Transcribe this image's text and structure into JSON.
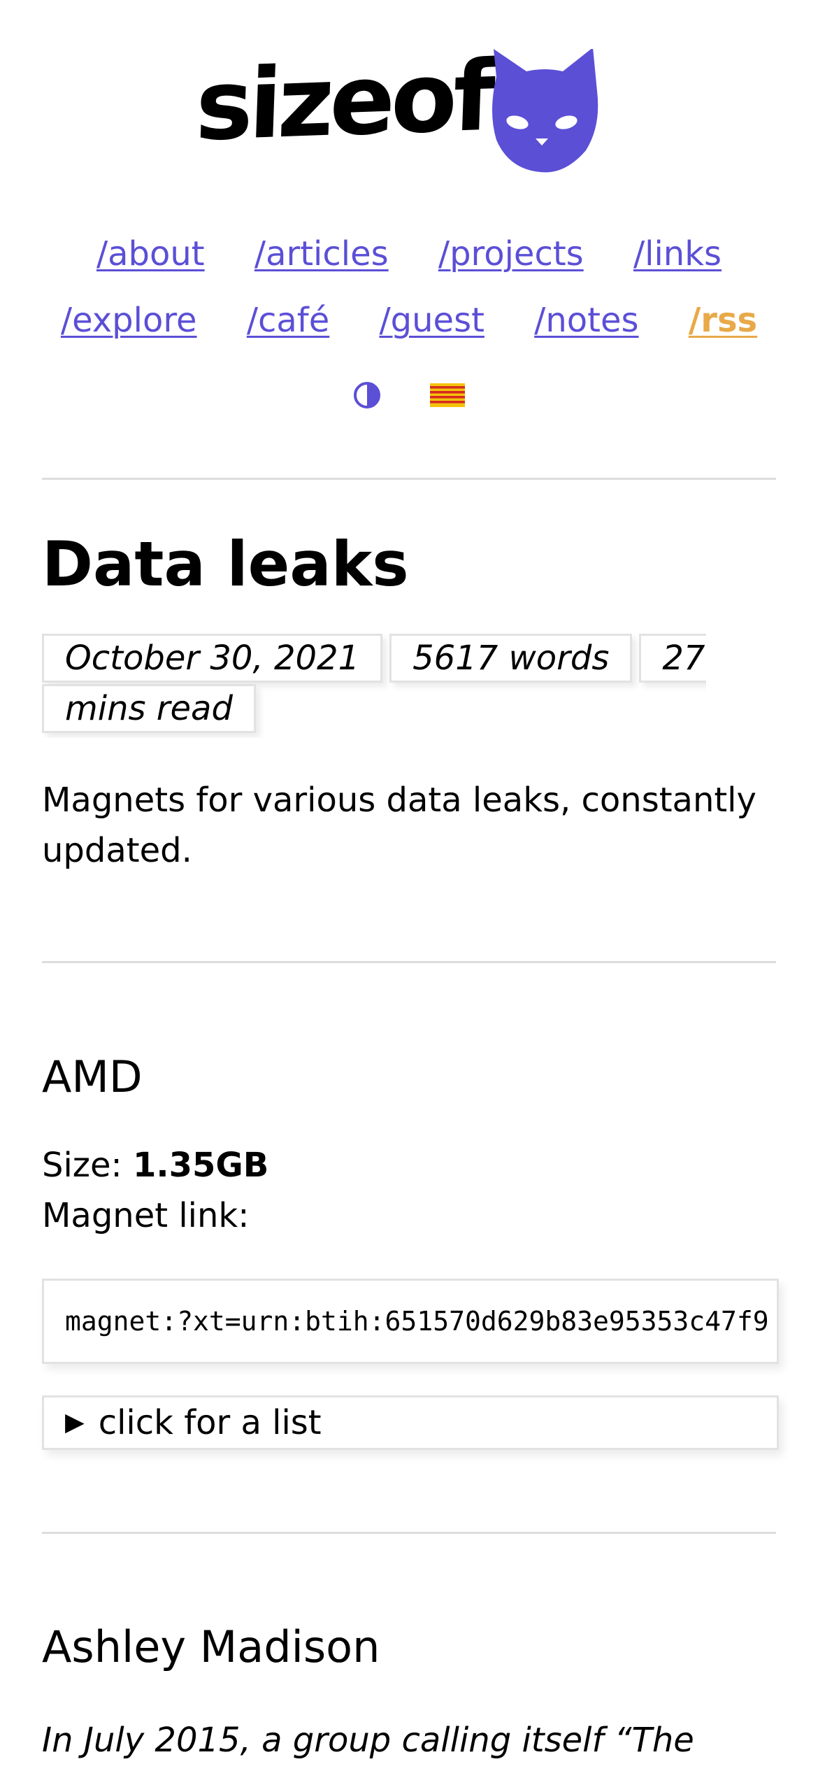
{
  "brand": {
    "name": "sizeof",
    "accent": "#5b4fd6",
    "rss_color": "#e8a948"
  },
  "nav": {
    "row1": [
      "/about",
      "/articles",
      "/projects",
      "/links"
    ],
    "row2": [
      "/explore",
      "/café",
      "/guest",
      "/notes"
    ],
    "rss": "/rss"
  },
  "toolbar": {
    "theme_icon": "half-circle-contrast-icon",
    "language_icon": "catalan-flag-icon"
  },
  "article": {
    "title": "Data leaks",
    "date": "October 30, 2021",
    "words": "5617 words",
    "reading_time": "27 mins read",
    "lead": "Magnets for various data leaks, constantly updated."
  },
  "sections": [
    {
      "heading": "AMD",
      "size_label": "Size: ",
      "size_value": "1.35GB",
      "magnet_label": "Magnet link:",
      "magnet": "magnet:?xt=urn:btih:651570d629b83e95353c47f9",
      "details_label": "click for a list"
    },
    {
      "heading": "Ashley Madison",
      "intro": "In July 2015, a group calling itself “The"
    }
  ]
}
